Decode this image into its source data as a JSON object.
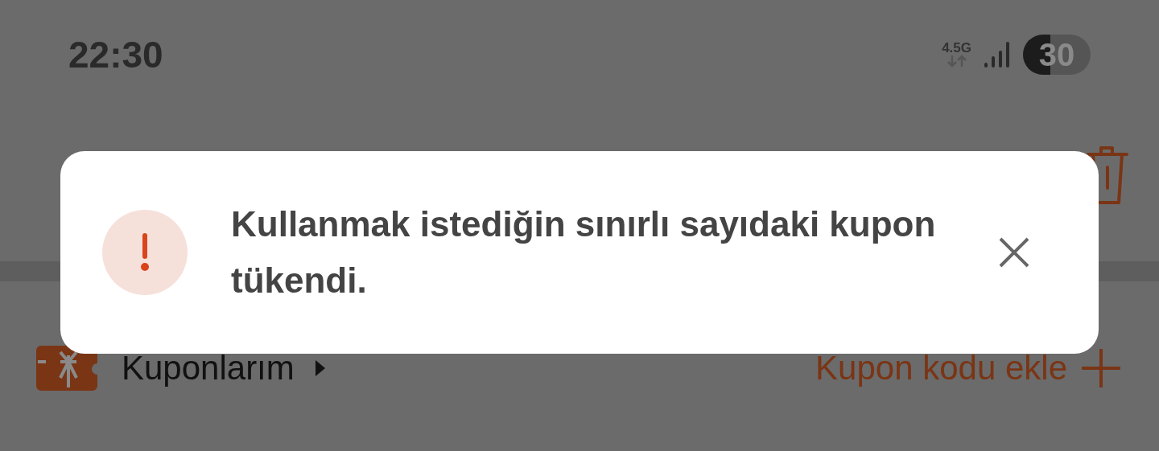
{
  "status_bar": {
    "time": "22:30",
    "network": "4.5G",
    "battery": "30"
  },
  "coupons": {
    "my_coupons": "Kuponlarım",
    "add_code": "Kupon kodu ekle"
  },
  "toast": {
    "message": "Kullanmak istediğin sınırlı sayıdaki kupon tükendi.",
    "kind": "error"
  }
}
